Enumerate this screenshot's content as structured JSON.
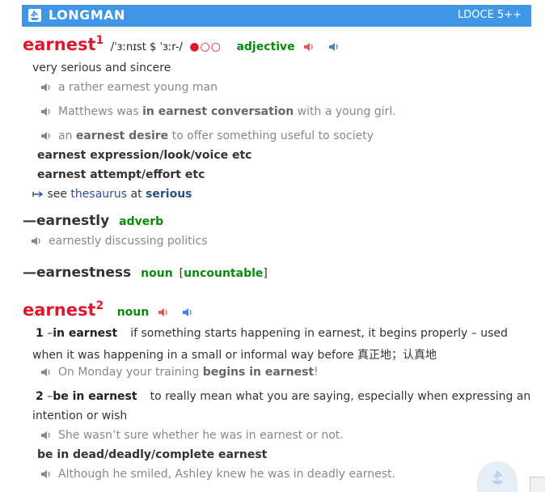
{
  "header": {
    "brand": "LONGMAN",
    "edition": "LDOCE 5++"
  },
  "entry1": {
    "word": "earnest",
    "homnum": "1",
    "pron": "/ˈɜːnɪst $ ˈɜːr-/",
    "freq": "●○○",
    "pos": "adjective",
    "definition": "very serious and sincere",
    "ex1": "a rather earnest young man",
    "ex2_a": "Matthews was ",
    "ex2_b": "in earnest conversation",
    "ex2_c": " with a young girl.",
    "ex3_a": "an ",
    "ex3_b": "earnest desire",
    "ex3_c": " to offer something useful to society",
    "colloc1": "earnest expression/look/voice etc",
    "colloc2": "earnest attempt/effort etc",
    "see_a": " see ",
    "see_link": "thesaurus",
    "see_b": " at ",
    "see_target": "serious"
  },
  "runon1": {
    "word": "—earnestly",
    "pos": "adverb",
    "ex": "earnestly discussing politics"
  },
  "runon2": {
    "word": "—earnestness",
    "pos": "noun",
    "gram": "uncountable"
  },
  "entry2": {
    "word": "earnest",
    "homnum": "2",
    "pos": "noun",
    "sense1": {
      "num": "1",
      "dash": " –",
      "signpost": "in earnest",
      "def_line1": "if something starts happening in earnest, it begins properly – used",
      "def_line2": "when it was happening in a small or informal way before 真正地；认真地",
      "ex_a": "On Monday your training ",
      "ex_b": "begins in earnest",
      "ex_c": "!"
    },
    "sense2": {
      "num": "2",
      "dash": " –",
      "signpost": "be in earnest",
      "def_line1": "to really mean what you are saying, especially when expressing an",
      "def_line2": "intention or wish",
      "ex": "She wasn’t sure whether he was in earnest or not.",
      "colloc": "be in dead/deadly/complete earnest",
      "ex2": "Although he smiled, Ashley knew he was in deadly earnest."
    }
  },
  "colors": {
    "header": "#3f96e4",
    "headword": "#e0182d",
    "pos": "#0a8a0a",
    "link": "#2b4f8a"
  }
}
